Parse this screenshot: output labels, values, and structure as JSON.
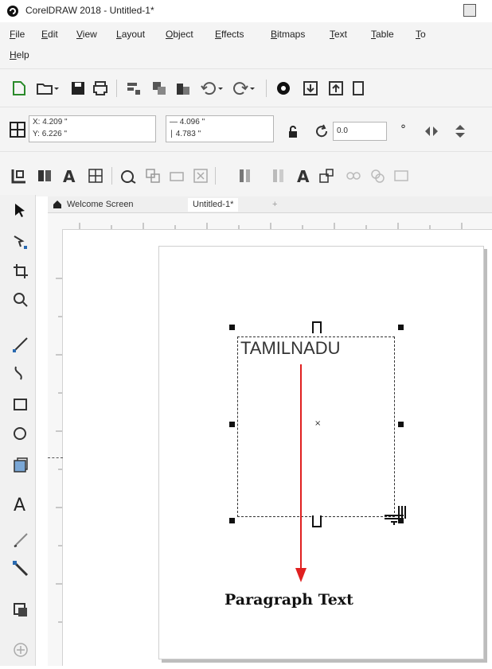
{
  "window": {
    "title": "CorelDRAW 2018 - Untitled-1*"
  },
  "menu": {
    "items": [
      "File",
      "Edit",
      "View",
      "Layout",
      "Object",
      "Effects",
      "Bitmaps",
      "Text",
      "Table",
      "To",
      "Help"
    ]
  },
  "property_bar": {
    "x_label": "X:",
    "x_value": "4.209 \"",
    "y_label": "Y:",
    "y_value": "6.226 \"",
    "width_value": "4.096 \"",
    "height_value": "4.783 \"",
    "rotation_value": "0.0",
    "degree_symbol": "°"
  },
  "tabs": {
    "welcome": "Welcome Screen",
    "document": "Untitled-1*",
    "add": "+"
  },
  "canvas": {
    "frame_text": "TAMILNADU",
    "center_mark": "×"
  },
  "annotation": {
    "caption": "Paragraph Text",
    "arrow_color": "#e02020"
  },
  "colors": {
    "menubar_bg": "#f4f4f4",
    "handle": "#111111",
    "frame_border": "#333333"
  }
}
